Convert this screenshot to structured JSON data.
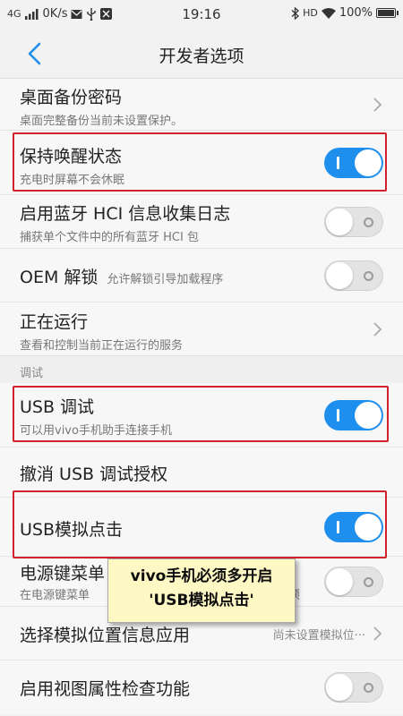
{
  "status_bar": {
    "network": "4G",
    "speed": "0K/s",
    "time": "19:16",
    "hd": "HD",
    "battery": "100%",
    "icons": [
      "signal-icon",
      "mail-icon",
      "usb-icon",
      "tools-icon",
      "bluetooth-icon",
      "wifi-icon",
      "battery-icon"
    ]
  },
  "header": {
    "title": "开发者选项",
    "back_icon": "chevron-left-icon",
    "accent_color": "#1e8fec"
  },
  "settings": {
    "backup_password": {
      "title": "桌面备份密码",
      "subtitle": "桌面完整备份当前未设置保护。"
    },
    "stay_awake": {
      "title": "保持唤醒状态",
      "subtitle": "充电时屏幕不会休眠",
      "enabled": true
    },
    "bt_hci_log": {
      "title": "启用蓝牙 HCI 信息收集日志",
      "subtitle": "捕获单个文件中的所有蓝牙 HCI 包",
      "enabled": false
    },
    "oem_unlock": {
      "title": "OEM 解锁",
      "subtitle": "允许解锁引导加载程序",
      "enabled": false
    },
    "running": {
      "title": "正在运行",
      "subtitle": "查看和控制当前正在运行的服务"
    },
    "debug_section": "调试",
    "usb_debug": {
      "title": "USB 调试",
      "subtitle": "可以用vivo手机助手连接手机",
      "enabled": true
    },
    "revoke_usb": {
      "title": "撤消 USB 调试授权"
    },
    "usb_sim_click": {
      "title": "USB模拟点击",
      "enabled": true
    },
    "power_menu": {
      "title": "电源键菜单",
      "subtitle": "在电源键菜单",
      "subtitle_tail": "项",
      "enabled": false
    },
    "mock_location": {
      "title": "选择模拟位置信息应用",
      "value": "尚未设置模拟位···"
    },
    "view_attr": {
      "title": "启用视图属性检查功能",
      "enabled": false
    }
  },
  "annotation": {
    "line1": "vivo手机必须多开启",
    "line2": "'USB模拟点击'",
    "highlight_color": "#d2222c"
  }
}
